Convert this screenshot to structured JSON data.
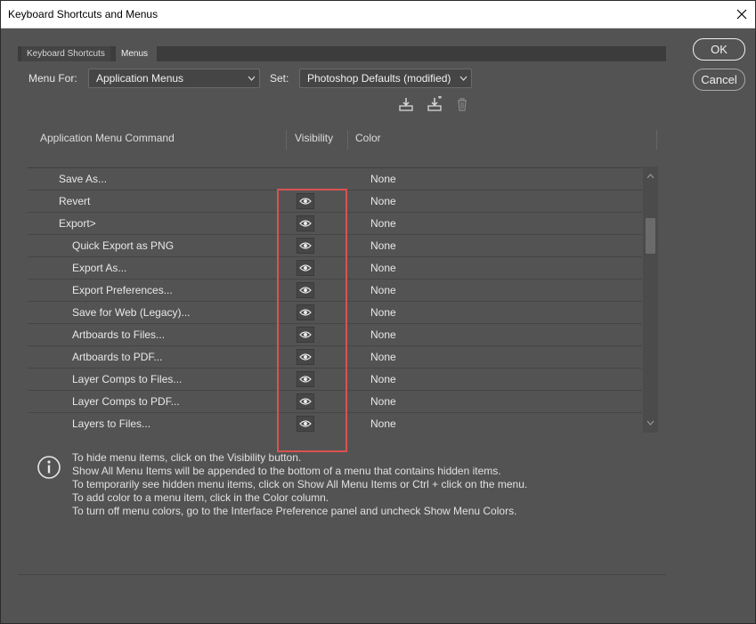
{
  "window": {
    "title": "Keyboard Shortcuts and Menus"
  },
  "tabs": [
    {
      "label": "Keyboard Shortcuts",
      "active": false
    },
    {
      "label": "Menus",
      "active": true
    }
  ],
  "controls": {
    "menu_for_label": "Menu For:",
    "menu_for_value": "Application Menus",
    "set_label": "Set:",
    "set_value": "Photoshop Defaults (modified)"
  },
  "table": {
    "headers": {
      "command": "Application Menu Command",
      "visibility": "Visibility",
      "color": "Color"
    },
    "rows": [
      {
        "command": "Save As...",
        "indent": 1,
        "visible": null,
        "color": "None"
      },
      {
        "command": "Revert",
        "indent": 1,
        "visible": true,
        "color": "None"
      },
      {
        "command": "Export>",
        "indent": 1,
        "visible": true,
        "color": "None"
      },
      {
        "command": "Quick Export as PNG",
        "indent": 2,
        "visible": true,
        "color": "None"
      },
      {
        "command": "Export As...",
        "indent": 2,
        "visible": true,
        "color": "None"
      },
      {
        "command": "Export Preferences...",
        "indent": 2,
        "visible": true,
        "color": "None"
      },
      {
        "command": "Save for Web (Legacy)...",
        "indent": 2,
        "visible": true,
        "color": "None"
      },
      {
        "command": "Artboards to Files...",
        "indent": 2,
        "visible": true,
        "color": "None"
      },
      {
        "command": "Artboards to PDF...",
        "indent": 2,
        "visible": true,
        "color": "None"
      },
      {
        "command": "Layer Comps to Files...",
        "indent": 2,
        "visible": true,
        "color": "None"
      },
      {
        "command": "Layer Comps to PDF...",
        "indent": 2,
        "visible": true,
        "color": "None"
      },
      {
        "command": "Layers to Files...",
        "indent": 2,
        "visible": true,
        "color": "None"
      }
    ]
  },
  "info_lines": [
    "To hide menu items, click on the Visibility button.",
    "Show All Menu Items will be appended to the bottom of a menu that contains hidden items.",
    "To temporarily see hidden menu items, click on Show All Menu Items or Ctrl + click on the menu.",
    "To add color to a menu item, click in the Color column.",
    "To turn off menu colors, go to the Interface Preference panel and uncheck Show Menu Colors."
  ],
  "buttons": {
    "ok": "OK",
    "cancel": "Cancel"
  },
  "colors": {
    "highlight": "#d9534f",
    "panel": "#535353"
  }
}
